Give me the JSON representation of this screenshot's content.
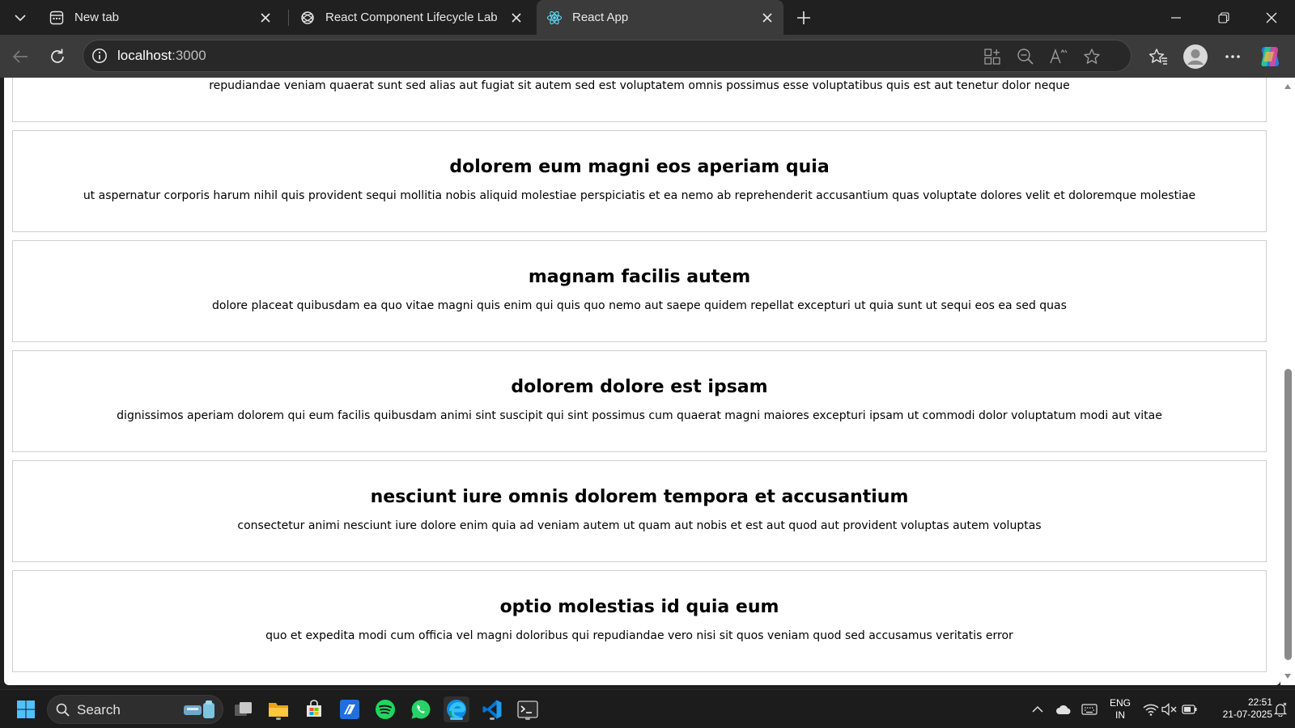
{
  "browser": {
    "tabs": [
      {
        "title": "New tab",
        "icon": "new-tab-icon",
        "active": false
      },
      {
        "title": "React Component Lifecycle Lab",
        "icon": "chatgpt-icon",
        "active": false
      },
      {
        "title": "React App",
        "icon": "react-icon",
        "active": true
      }
    ],
    "address": {
      "host": "localhost",
      "port": ":3000"
    }
  },
  "page": {
    "posts": [
      {
        "title": "",
        "body": "repudiandae veniam quaerat sunt sed alias aut fugiat sit autem sed est voluptatem omnis possimus esse voluptatibus quis est aut tenetur dolor neque"
      },
      {
        "title": "dolorem eum magni eos aperiam quia",
        "body": "ut aspernatur corporis harum nihil quis provident sequi mollitia nobis aliquid molestiae perspiciatis et ea nemo ab reprehenderit accusantium quas voluptate dolores velit et doloremque molestiae"
      },
      {
        "title": "magnam facilis autem",
        "body": "dolore placeat quibusdam ea quo vitae magni quis enim qui quis quo nemo aut saepe quidem repellat excepturi ut quia sunt ut sequi eos ea sed quas"
      },
      {
        "title": "dolorem dolore est ipsam",
        "body": "dignissimos aperiam dolorem qui eum facilis quibusdam animi sint suscipit qui sint possimus cum quaerat magni maiores excepturi ipsam ut commodi dolor voluptatum modi aut vitae"
      },
      {
        "title": "nesciunt iure omnis dolorem tempora et accusantium",
        "body": "consectetur animi nesciunt iure dolore enim quia ad veniam autem ut quam aut nobis et est aut quod aut provident voluptas autem voluptas"
      },
      {
        "title": "optio molestias id quia eum",
        "body": "quo et expedita modi cum officia vel magni doloribus qui repudiandae vero nisi sit quos veniam quod sed accusamus veritatis error"
      }
    ]
  },
  "taskbar": {
    "search_label": "Search",
    "language": {
      "line1": "ENG",
      "line2": "IN"
    },
    "clock": {
      "time": "22:51",
      "date": "21-07-2025"
    }
  },
  "colors": {
    "chrome_dark": "#202020",
    "chrome_toolbar": "#3b3b3b",
    "accent": "#4cc2ff"
  }
}
